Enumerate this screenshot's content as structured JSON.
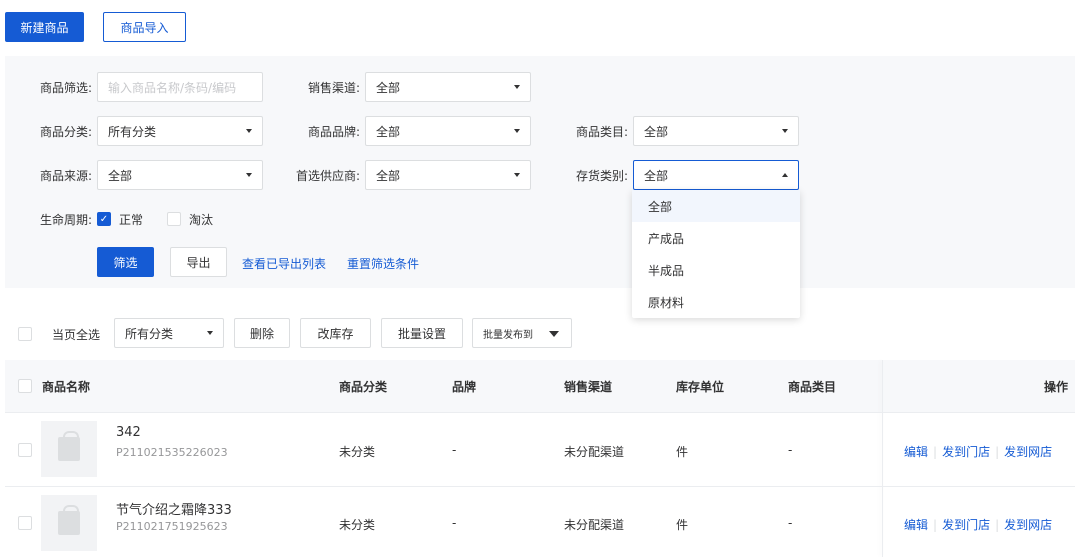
{
  "toolbar": {
    "new_product": "新建商品",
    "import_product": "商品导入"
  },
  "filters": {
    "product_filter_label": "商品筛选:",
    "product_filter_placeholder": "输入商品名称/条码/编码",
    "sales_channel_label": "销售渠道:",
    "sales_channel_value": "全部",
    "product_category_label": "商品分类:",
    "product_category_value": "所有分类",
    "brand_label": "商品品牌:",
    "brand_value": "全部",
    "catalog_label": "商品类目:",
    "catalog_value": "全部",
    "source_label": "商品来源:",
    "source_value": "全部",
    "supplier_label": "首选供应商:",
    "supplier_value": "全部",
    "stock_type_label": "存货类别:",
    "stock_type_value": "全部",
    "lifecycle_label": "生命周期:",
    "lifecycle_normal": "正常",
    "lifecycle_obsolete": "淘汰",
    "filter_button": "筛选",
    "export_button": "导出",
    "view_exports_link": "查看已导出列表",
    "reset_link": "重置筛选条件"
  },
  "stock_type_dropdown": {
    "options": [
      "全部",
      "产成品",
      "半成品",
      "原材料"
    ],
    "selected": "全部"
  },
  "bulk_actions": {
    "select_all_label": "当页全选",
    "category_select_value": "所有分类",
    "delete_button": "删除",
    "edit_stock_button": "改库存",
    "batch_settings_button": "批量设置",
    "batch_publish_button": "批量发布到"
  },
  "table": {
    "headers": {
      "name": "商品名称",
      "category": "商品分类",
      "brand": "品牌",
      "channel": "销售渠道",
      "unit": "库存单位",
      "catalog": "商品类目",
      "actions": "操作"
    },
    "rows": [
      {
        "name": "342",
        "code": "P211021535226023",
        "category": "未分类",
        "brand": "-",
        "channel": "未分配渠道",
        "unit": "件",
        "catalog": "-",
        "action_edit": "编辑",
        "action_store": "发到门店",
        "action_web": "发到网店"
      },
      {
        "name": "节气介绍之霜降333",
        "code": "P211021751925623",
        "category": "未分类",
        "brand": "-",
        "channel": "未分配渠道",
        "unit": "件",
        "catalog": "-",
        "action_edit": "编辑",
        "action_store": "发到门店",
        "action_web": "发到网店"
      }
    ]
  },
  "colors": {
    "primary": "#155bd4",
    "panel_bg": "#f7f8fa",
    "border": "#dcdee0"
  }
}
